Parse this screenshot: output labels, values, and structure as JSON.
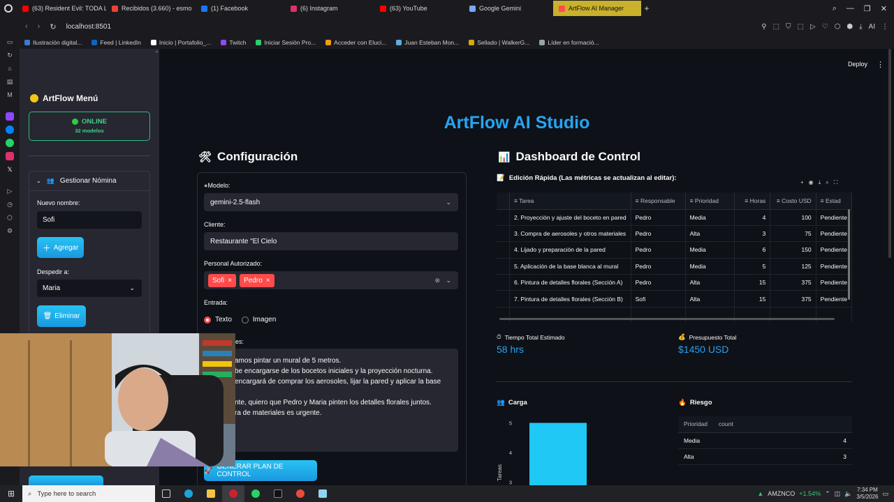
{
  "browser": {
    "tabs": [
      {
        "label": "(63) Resident Evil: TODA L",
        "color": "#ff0000"
      },
      {
        "label": "Recibidos (3.660) - esmo",
        "color": "#ea4335"
      },
      {
        "label": "(1) Facebook",
        "color": "#1877f2"
      },
      {
        "label": "(6) Instagram",
        "color": "#e1306c"
      },
      {
        "label": "(63) YouTube",
        "color": "#ff0000"
      },
      {
        "label": "Google Gemini",
        "color": "#7aa7ff"
      },
      {
        "label": "ArtFlow AI Manager",
        "color": "#ff4b4b"
      }
    ],
    "url": "localhost:8501",
    "bookmarks": [
      {
        "label": "Ilustración digital...",
        "color": "#3a7bd5"
      },
      {
        "label": "Feed | LinkedIn",
        "color": "#0a66c2"
      },
      {
        "label": "Inicio | Portafolio_...",
        "color": "#ffffff"
      },
      {
        "label": "Twitch",
        "color": "#9146ff"
      },
      {
        "label": "Iniciar Sesión Pro...",
        "color": "#2ecc71"
      },
      {
        "label": "Acceder con Eluci...",
        "color": "#f39c12"
      },
      {
        "label": "Juan Esteban Mon...",
        "color": "#5dade2"
      },
      {
        "label": "Sellado | WalkerG...",
        "color": "#d4ac0d"
      },
      {
        "label": "Líder en formació...",
        "color": "#95a5a6"
      }
    ]
  },
  "sidebar": {
    "title": "ArtFlow Menú",
    "status": "ONLINE",
    "models": "32 modelos",
    "expander_title": "Gestionar Nómina",
    "new_name_label": "Nuevo nombre:",
    "new_name_value": "Sofi",
    "add_button": "Agregar",
    "fire_label": "Despedir a:",
    "fire_value": "Maria",
    "delete_button": "Eliminar"
  },
  "header": {
    "deploy": "Deploy"
  },
  "app_title": "ArtFlow AI Studio",
  "config": {
    "title": "Configuración",
    "model_label": "Modelo:",
    "model_value": "gemini-2.5-flash",
    "client_label": "Cliente:",
    "client_value": "Restaurante \"El Cielo",
    "staff_label": "Personal Autorizado:",
    "staff_tags": [
      "Sofi",
      "Pedro"
    ],
    "input_label": "Entrada:",
    "radio_text": "Texto",
    "radio_image": "Imagen",
    "notes_label": "es:",
    "notes_lines": [
      "amos pintar un mural de 5 metros.",
      "be encargarse de los bocetos iniciales y la proyección nocturna.",
      "encargará de comprar los aerosoles, lijar la pared y aplicar la base",
      "",
      "nte, quiero que Pedro y Maria pinten los detalles florales juntos.",
      "ra de materiales es urgente."
    ],
    "generate_button": "GENERAR PLAN DE CONTROL"
  },
  "dashboard": {
    "title": "Dashboard de Control",
    "subtitle": "Edición Rápida (Las métricas se actualizan al editar):",
    "columns": [
      "Tarea",
      "Responsable",
      "Prioridad",
      "Horas",
      "Costo USD",
      "Estad"
    ],
    "rows": [
      [
        "2. Proyección y ajuste del boceto en pared",
        "Pedro",
        "Media",
        "4",
        "100",
        "Pendiente"
      ],
      [
        "3. Compra de aerosoles y otros materiales",
        "Pedro",
        "Alta",
        "3",
        "75",
        "Pendiente"
      ],
      [
        "4. Lijado y preparación de la pared",
        "Pedro",
        "Media",
        "6",
        "150",
        "Pendiente"
      ],
      [
        "5. Aplicación de la base blanca al mural",
        "Pedro",
        "Media",
        "5",
        "125",
        "Pendiente"
      ],
      [
        "6. Pintura de detalles florales (Sección A)",
        "Pedro",
        "Alta",
        "15",
        "375",
        "Pendiente"
      ],
      [
        "7. Pintura de detalles florales (Sección B)",
        "Sofi",
        "Alta",
        "15",
        "375",
        "Pendiente"
      ]
    ],
    "time_label": "Tiempo Total Estimado",
    "time_value": "58 hrs",
    "budget_label": "Presupuesto Total",
    "budget_value": "$1450 USD",
    "load_title": "Carga",
    "risk_title": "Riesgo",
    "risk_columns": [
      "Prioridad",
      "count"
    ],
    "risk_rows": [
      [
        "Media",
        "4"
      ],
      [
        "Alta",
        "3"
      ]
    ]
  },
  "chart_data": {
    "type": "bar",
    "title": "",
    "ylabel": "Tareas",
    "y_ticks": [
      "5",
      "4",
      "3"
    ],
    "ylim": [
      2.9,
      5.2
    ],
    "values": [
      5
    ],
    "color": "#1fc8f5"
  },
  "taskbar": {
    "search_placeholder": "Type here to search",
    "stock_name": "AMZNCO",
    "stock_change": "+1.54%",
    "time": "7:34 PM",
    "date": "3/5/2026"
  }
}
